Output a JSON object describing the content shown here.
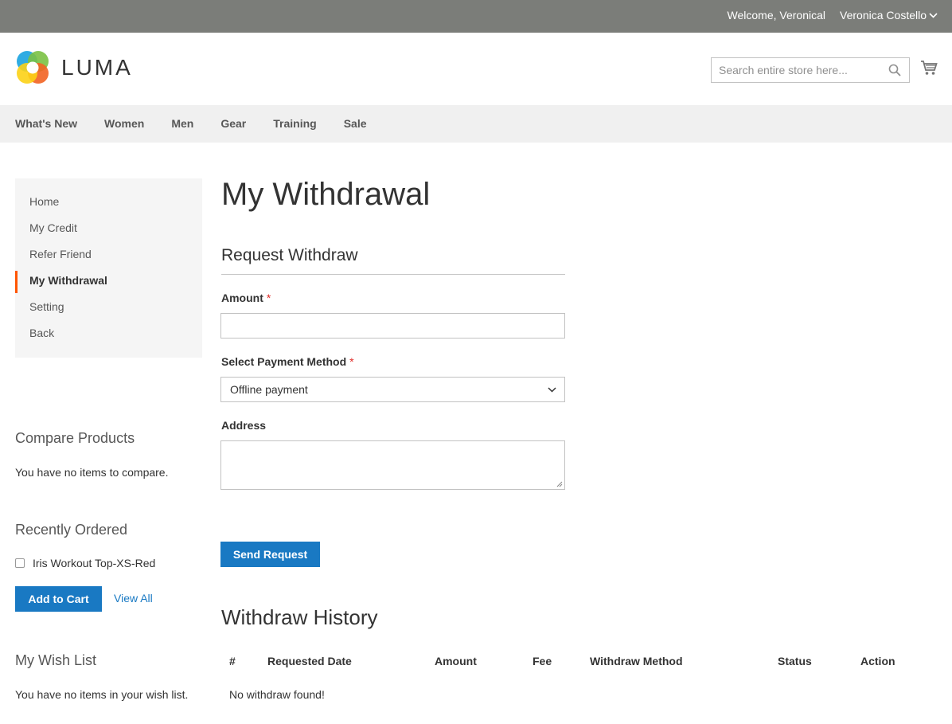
{
  "topbar": {
    "welcome": "Welcome, Veronical",
    "account_name": "Veronica Costello"
  },
  "header": {
    "logo_text": "LUMA",
    "search_placeholder": "Search entire store here...",
    "search_icon": "search-icon",
    "cart_icon": "cart-icon"
  },
  "nav": {
    "items": [
      "What's New",
      "Women",
      "Men",
      "Gear",
      "Training",
      "Sale"
    ]
  },
  "sidebar": {
    "items": [
      {
        "label": "Home",
        "active": false
      },
      {
        "label": "My Credit",
        "active": false
      },
      {
        "label": "Refer Friend",
        "active": false
      },
      {
        "label": "My Withdrawal",
        "active": true
      },
      {
        "label": "Setting",
        "active": false
      },
      {
        "label": "Back",
        "active": false
      }
    ],
    "compare": {
      "title": "Compare Products",
      "text": "You have no items to compare."
    },
    "recent": {
      "title": "Recently Ordered",
      "item": "Iris Workout Top-XS-Red",
      "add_to_cart": "Add to Cart",
      "view_all": "View All"
    },
    "wishlist": {
      "title": "My Wish List",
      "text": "You have no items in your wish list."
    }
  },
  "main": {
    "page_title": "My Withdrawal",
    "form": {
      "title": "Request Withdraw",
      "amount_label": "Amount",
      "amount_value": "",
      "payment_label": "Select Payment Method",
      "payment_value": "Offline payment",
      "address_label": "Address",
      "address_value": "",
      "required_mark": "*",
      "submit": "Send Request"
    },
    "history": {
      "title": "Withdraw History",
      "columns": [
        "#",
        "Requested Date",
        "Amount",
        "Fee",
        "Withdraw Method",
        "Status",
        "Action"
      ],
      "empty": "No withdraw found!"
    }
  },
  "colors": {
    "accent": "#1979c3",
    "active_marker": "#ff5501",
    "topbar": "#7b7d79",
    "required": "#e02b27"
  }
}
